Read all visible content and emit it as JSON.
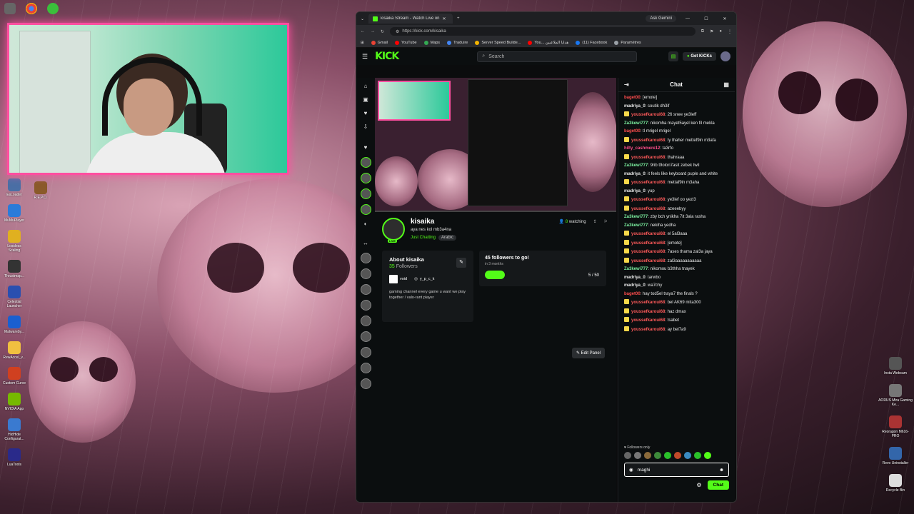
{
  "colors": {
    "accent": "#53fc18",
    "webcam_border": "#ff4fa0"
  },
  "desktop": {
    "left_icons": [
      {
        "label": "EsLoader",
        "color": "#4a6fa5"
      },
      {
        "label": "MuMuPlayer",
        "color": "#2b7bd9"
      },
      {
        "label": "Lossless Scaling",
        "color": "#e0b020"
      },
      {
        "label": "Thrustmap...",
        "color": "#333333"
      },
      {
        "label": "Celestial Launcher",
        "color": "#2a4fb0"
      },
      {
        "label": "Malwareby...",
        "color": "#1a5fd0"
      },
      {
        "label": "RewAccel_v...",
        "color": "#f0c040"
      },
      {
        "label": "Custom Curve",
        "color": "#d04020"
      },
      {
        "label": "NVIDIA App",
        "color": "#76b900"
      },
      {
        "label": "HidHide Configurat...",
        "color": "#3a7ad0"
      },
      {
        "label": "LuaTools",
        "color": "#2a2a8a"
      }
    ],
    "repo_label": "R.E.P.O.",
    "right_icons": [
      {
        "label": "Insta Webcam",
        "color": "#555555"
      },
      {
        "label": "AORUS Mira Gaming Ke...",
        "color": "#777777"
      },
      {
        "label": "Reoragon M616-PRO",
        "color": "#aa3333"
      },
      {
        "label": "Revo Uninstaller",
        "color": "#3366aa"
      },
      {
        "label": "Recycle Bin",
        "color": "#dddddd"
      }
    ]
  },
  "browser": {
    "tab_title": "kisaika Stream - Watch Live on",
    "new_tab": "+",
    "gemini": "Ask Gemini",
    "win_controls": {
      "min": "—",
      "max": "☐",
      "close": "✕"
    },
    "url": "https://kick.com/kisaika",
    "bookmarks": [
      {
        "label": "Gmail",
        "color": "#ea4335"
      },
      {
        "label": "YouTube",
        "color": "#ff0000"
      },
      {
        "label": "Maps",
        "color": "#34a853"
      },
      {
        "label": "Traduire",
        "color": "#4285f4"
      },
      {
        "label": "Server Speed Builde...",
        "color": "#f4b400"
      },
      {
        "label": "You... هدايا الملاعبين",
        "color": "#ff0000"
      },
      {
        "label": "(11) Facebook",
        "color": "#1877f2"
      },
      {
        "label": "Paramètres",
        "color": "#9aa0a6"
      }
    ]
  },
  "kick": {
    "logo": "KICK",
    "search_placeholder": "Search",
    "get_kicks": "Get KICKs",
    "streamer": {
      "name": "kisaika",
      "title": "aya nes kol mb3a4na",
      "category": "Just Chatting",
      "tag": "Arabic",
      "live": "LIVE",
      "watching_count": "8",
      "watching_label": "watching"
    },
    "about": {
      "heading": "About kisaika",
      "followers_count": "35",
      "followers_label": "Followers",
      "social_1": "void",
      "social_2": "y_p_c_k",
      "description": "gaming channel every game u want we play together / valo-rant player"
    },
    "goal": {
      "title": "45 followers to go!",
      "period": "in 3 months",
      "progress": 0.1,
      "count": "5 / 50"
    },
    "edit_panel": "Edit Panel"
  },
  "chat": {
    "header": "Chat",
    "messages": [
      {
        "user": "baget00",
        "color": "#ff4d4d",
        "badge": false,
        "text": "[emote]"
      },
      {
        "user": "madriya_0",
        "color": "#e8e8e8",
        "badge": false,
        "text": "soutik dh3if"
      },
      {
        "user": "youssefkaroui68",
        "color": "#ff5a5a",
        "badge": true,
        "text": "26 snee ye3leff"
      },
      {
        "user": "Za3kewi777",
        "color": "#7cf0a0",
        "badge": false,
        "text": "nikomha mayet5ayel ken fil mekla"
      },
      {
        "user": "baget00",
        "color": "#ff4d4d",
        "badge": false,
        "text": "tl mrigel mrigel"
      },
      {
        "user": "youssefkaroui68",
        "color": "#ff5a5a",
        "badge": true,
        "text": "ty thaher mettef9in m3afa"
      },
      {
        "user": "hilty_cashmere12",
        "color": "#ff4d8a",
        "badge": false,
        "text": "ta3rfo"
      },
      {
        "user": "youssefkaroui68",
        "color": "#ff5a5a",
        "badge": true,
        "text": "thahraaa"
      },
      {
        "user": "Za3kewi777",
        "color": "#7cf0a0",
        "badge": false,
        "text": "9rib t9olon7asit zebek twil"
      },
      {
        "user": "madriya_0",
        "color": "#e8e8e8",
        "badge": false,
        "text": "it feels like keyboard puple and white"
      },
      {
        "user": "youssefkaroui68",
        "color": "#ff5a5a",
        "badge": true,
        "text": "mettaf9in m3aha"
      },
      {
        "user": "madriya_0",
        "color": "#e8e8e8",
        "badge": false,
        "text": "yup"
      },
      {
        "user": "youssefkaroui68",
        "color": "#ff5a5a",
        "badge": true,
        "text": "ye3lef oo yezl3"
      },
      {
        "user": "youssefkaroui68",
        "color": "#ff5a5a",
        "badge": true,
        "text": "azeeebyy"
      },
      {
        "user": "Za3kewi777",
        "color": "#7cf0a0",
        "badge": false,
        "text": "zby bch ynikha 7it 3ala rasha"
      },
      {
        "user": "Za3kewi777",
        "color": "#7cf0a0",
        "badge": false,
        "text": "nekiha yedha"
      },
      {
        "user": "youssefkaroui68",
        "color": "#ff5a5a",
        "badge": true,
        "text": "el 5al3aaa"
      },
      {
        "user": "youssefkaroui68",
        "color": "#ff5a5a",
        "badge": true,
        "text": "[emote]"
      },
      {
        "user": "youssefkaroui68",
        "color": "#ff5a5a",
        "badge": true,
        "text": "7ases thama zal3a jaya"
      },
      {
        "user": "youssefkaroui68",
        "color": "#ff5a5a",
        "badge": true,
        "text": "zal3aaaaaaaaaaa"
      },
      {
        "user": "Za3kewi777",
        "color": "#7cf0a0",
        "badge": false,
        "text": "nikomou b3thha tnayek"
      },
      {
        "user": "madriya_0",
        "color": "#e8e8e8",
        "badge": false,
        "text": "tarwbo"
      },
      {
        "user": "madriya_0",
        "color": "#e8e8e8",
        "badge": false,
        "text": "wa7chy"
      },
      {
        "user": "baget00",
        "color": "#ff4d4d",
        "badge": false,
        "text": "hay tod5el traya7 the finals ?"
      },
      {
        "user": "youssefkaroui68",
        "color": "#ff5a5a",
        "badge": true,
        "text": "bel AK69 mita300"
      },
      {
        "user": "youssefkaroui68",
        "color": "#ff5a5a",
        "badge": true,
        "text": "haz dmax"
      },
      {
        "user": "youssefkaroui68",
        "color": "#ff5a5a",
        "badge": true,
        "text": "tsabet"
      },
      {
        "user": "youssefkaroui68",
        "color": "#ff5a5a",
        "badge": true,
        "text": "ay bel7a9"
      }
    ],
    "followers_only": "Followers only",
    "input_value": "maghi",
    "send_label": "Chat"
  }
}
